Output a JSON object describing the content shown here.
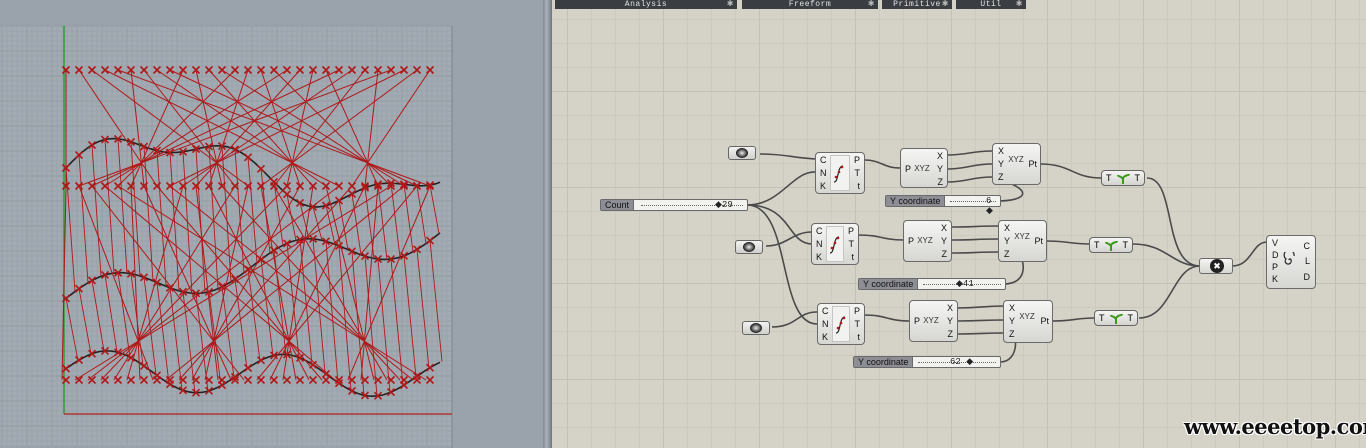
{
  "ribbon": {
    "tabs": [
      {
        "label": "Analysis",
        "pin": "✱"
      },
      {
        "label": "Freeform",
        "pin": "✱"
      },
      {
        "label": "Primitive",
        "pin": "✱"
      },
      {
        "label": "Util",
        "pin": "✱"
      }
    ]
  },
  "sliders": {
    "count": {
      "name": "Count",
      "value": "◆29"
    },
    "y1": {
      "name": "Y coordinate",
      "value": "6 ◆"
    },
    "y2": {
      "name": "Y coordinate",
      "value": "◆41"
    },
    "y3": {
      "name": "Y coordinate",
      "value": "62 ◆"
    }
  },
  "components": {
    "divide_curve": {
      "inputs": [
        "C",
        "N",
        "K"
      ],
      "outputs": [
        "P",
        "T",
        "t"
      ]
    },
    "deconstruct": {
      "inputs": [
        "P"
      ],
      "outputs": [
        "X",
        "Y",
        "Z"
      ],
      "icon": "XYZ"
    },
    "construct_point": {
      "inputs": [
        "X",
        "Y",
        "Z"
      ],
      "outputs": [
        "Pt"
      ],
      "icon": "XYZ"
    },
    "flatten": {
      "input": "T",
      "output": "T"
    },
    "merge_icon": "✖",
    "loft": {
      "inputs": [
        "V",
        "D",
        "P",
        "K"
      ],
      "outputs": [
        "C",
        "L",
        "D"
      ]
    }
  },
  "watermark": "www.eeeetop.com",
  "colors": {
    "curve_red": "#b01818",
    "curve_black": "#222222",
    "canvas_bg": "#d5d2c8",
    "viewport_bg": "#9aa3ab"
  }
}
